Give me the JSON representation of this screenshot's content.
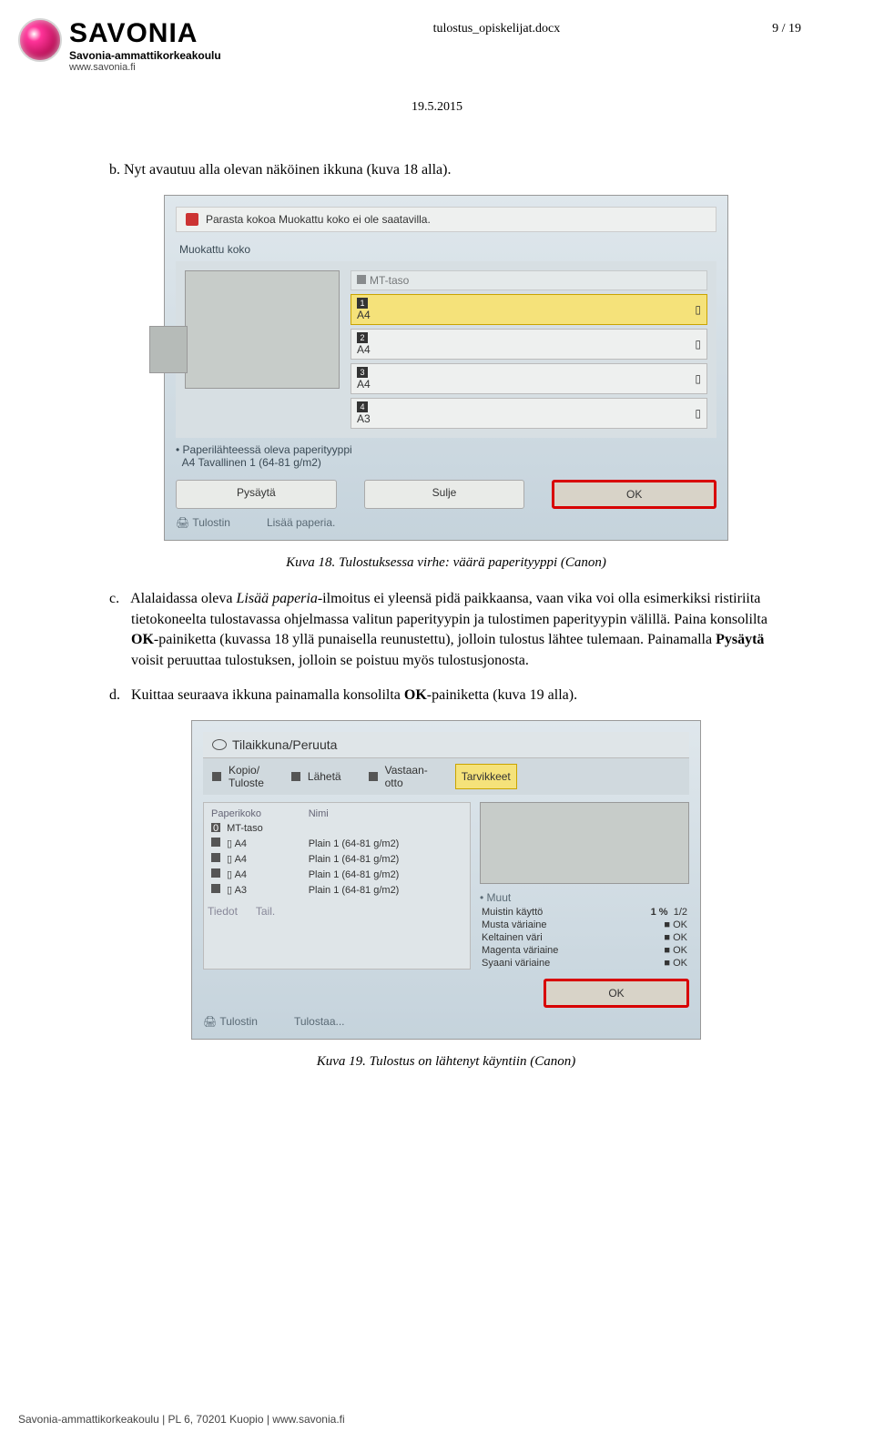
{
  "header": {
    "logo_title": "SAVONIA",
    "logo_sub": "Savonia-ammattikorkeakoulu",
    "logo_url": "www.savonia.fi",
    "doc_name": "tulostus_opiskelijat.docx",
    "page": "9 / 19",
    "date": "19.5.2015"
  },
  "content": {
    "b_text": "b.   Nyt avautuu alla olevan näköinen ikkuna (kuva 18 alla).",
    "caption18": "Kuva 18. Tulostuksessa virhe: väärä paperityyppi (Canon)",
    "c_text": "c.   Alalaidassa oleva Lisää paperia -ilmoitus ei yleensä pidä paikkaansa, vaan vika voi olla esimerkiksi ristiriita tietokoneelta tulostavassa ohjelmassa valitun paperityypin ja tulostimen paperityypin välillä. Paina konsolilta OK-painiketta (kuvassa 18 yllä punaisella reunustettu), jolloin tulostus lähtee tulemaan. Painamalla Pysäytä voisit peruuttaa tulostuksen, jolloin se poistuu myös tulostusjonosta.",
    "d_text": "d.   Kuittaa seuraava ikkuna painamalla konsolilta OK-painiketta (kuva 19 alla).",
    "caption19": "Kuva 19. Tulostus on lähtenyt käyntiin (Canon)"
  },
  "ss1": {
    "warn": "Parasta kokoa Muokattu koko ei ole saatavilla.",
    "title": "Muokattu koko",
    "mt": "MT-taso",
    "papertype_label": "Paperilähteessä oleva paperityyppi",
    "papertype_value": "A4   Tavallinen 1 (64-81 g/m2)",
    "btn_stop": "Pysäytä",
    "btn_close": "Sulje",
    "btn_ok": "OK",
    "foot_printer": "Tulostin",
    "foot_add": "Lisää paperia."
  },
  "ss1_trays": [
    {
      "num": "1",
      "label": "A4",
      "hi": true
    },
    {
      "num": "2",
      "label": "A4",
      "hi": false
    },
    {
      "num": "3",
      "label": "A4",
      "hi": false
    },
    {
      "num": "4",
      "label": "A3",
      "hi": false
    }
  ],
  "ss2": {
    "title": "Tilaikkuna/Peruuta",
    "tab1a": "Kopio/",
    "tab1b": "Tuloste",
    "tab2": "Lähetä",
    "tab3a": "Vastaan-",
    "tab3b": "otto",
    "tab4": "Tarvikkeet",
    "col1": "Paperikoko",
    "col2": "Nimi",
    "muut": "Muut",
    "mem_label": "Muistin käyttö",
    "mem_value": "1 %",
    "page_frac": "1/2",
    "btn_ok": "OK",
    "foot_printer": "Tulostin",
    "foot_status": "Tulostaa...",
    "tiedot": "Tiedot",
    "tail": "Tail."
  },
  "ss2_rows": [
    {
      "num": "0",
      "size": "MT-taso",
      "name": ""
    },
    {
      "num": "1",
      "size": "A4",
      "name": "Plain 1 (64-81 g/m2)"
    },
    {
      "num": "2",
      "size": "A4",
      "name": "Plain 1 (64-81 g/m2)"
    },
    {
      "num": "3",
      "size": "A4",
      "name": "Plain 1 (64-81 g/m2)"
    },
    {
      "num": "4",
      "size": "A3",
      "name": "Plain 1 (64-81 g/m2)"
    }
  ],
  "ss2_status": [
    {
      "label": "Musta väriaine",
      "value": "OK"
    },
    {
      "label": "Keltainen väri",
      "value": "OK"
    },
    {
      "label": "Magenta väriaine",
      "value": "OK"
    },
    {
      "label": "Syaani väriaine",
      "value": "OK"
    }
  ],
  "footer": {
    "text": "Savonia-ammattikorkeakoulu | PL 6, 70201 Kuopio | www.savonia.fi"
  }
}
